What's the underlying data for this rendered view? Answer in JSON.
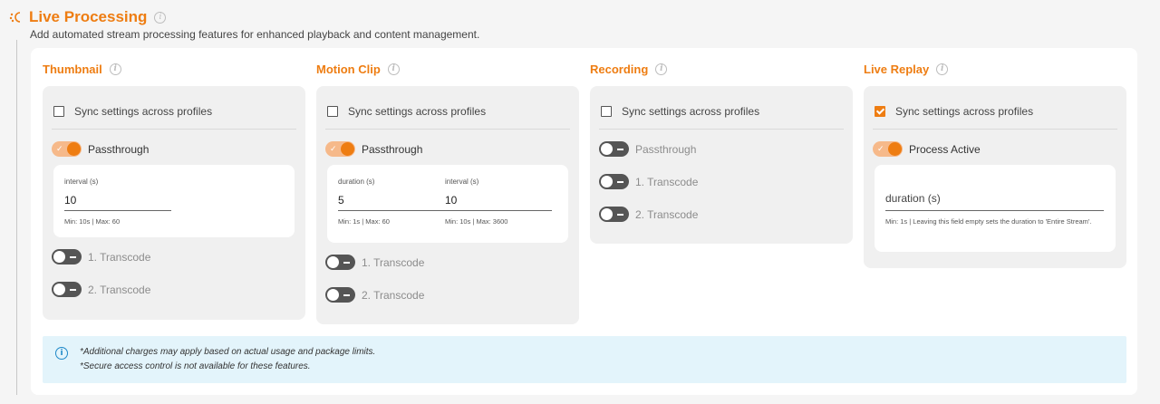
{
  "header": {
    "title": "Live Processing",
    "subtitle": "Add automated stream processing features for enhanced playback and content management."
  },
  "columns": [
    {
      "title": "Thumbnail",
      "sync_label": "Sync settings across profiles",
      "sync_checked": false,
      "main_toggle": {
        "label": "Passthrough",
        "on": true
      },
      "fields": [
        {
          "label": "interval (s)",
          "value": "10",
          "hint": "Min: 10s | Max: 60"
        }
      ],
      "transcodes": [
        {
          "label": "1. Transcode",
          "on": false
        },
        {
          "label": "2. Transcode",
          "on": false
        }
      ]
    },
    {
      "title": "Motion Clip",
      "sync_label": "Sync settings across profiles",
      "sync_checked": false,
      "main_toggle": {
        "label": "Passthrough",
        "on": true
      },
      "fields": [
        {
          "label": "duration (s)",
          "value": "5",
          "hint": "Min: 1s | Max: 60"
        },
        {
          "label": "interval (s)",
          "value": "10",
          "hint": "Min: 10s | Max: 3600"
        }
      ],
      "transcodes": [
        {
          "label": "1. Transcode",
          "on": false
        },
        {
          "label": "2. Transcode",
          "on": false
        }
      ]
    },
    {
      "title": "Recording",
      "sync_label": "Sync settings across profiles",
      "sync_checked": false,
      "main_toggle": {
        "label": "Passthrough",
        "on": false
      },
      "transcodes": [
        {
          "label": "1. Transcode",
          "on": false
        },
        {
          "label": "2. Transcode",
          "on": false
        }
      ]
    },
    {
      "title": "Live Replay",
      "sync_label": "Sync settings across profiles",
      "sync_checked": true,
      "main_toggle": {
        "label": "Process Active",
        "on": true
      },
      "fields": [
        {
          "label": "duration (s)",
          "value": "",
          "hint": "Min: 1s | Leaving this field empty sets the duration to 'Entire Stream'."
        }
      ]
    }
  ],
  "notice": {
    "line1": "*Additional charges may apply based on actual usage and package limits.",
    "line2": "*Secure access control is not available for these features."
  },
  "colors": {
    "accent": "#ee7d12",
    "toggle_on_track": "#f6b98a",
    "toggle_off_track": "#555555",
    "notice_bg": "#e3f4fb",
    "info_blue": "#1e88c8"
  }
}
